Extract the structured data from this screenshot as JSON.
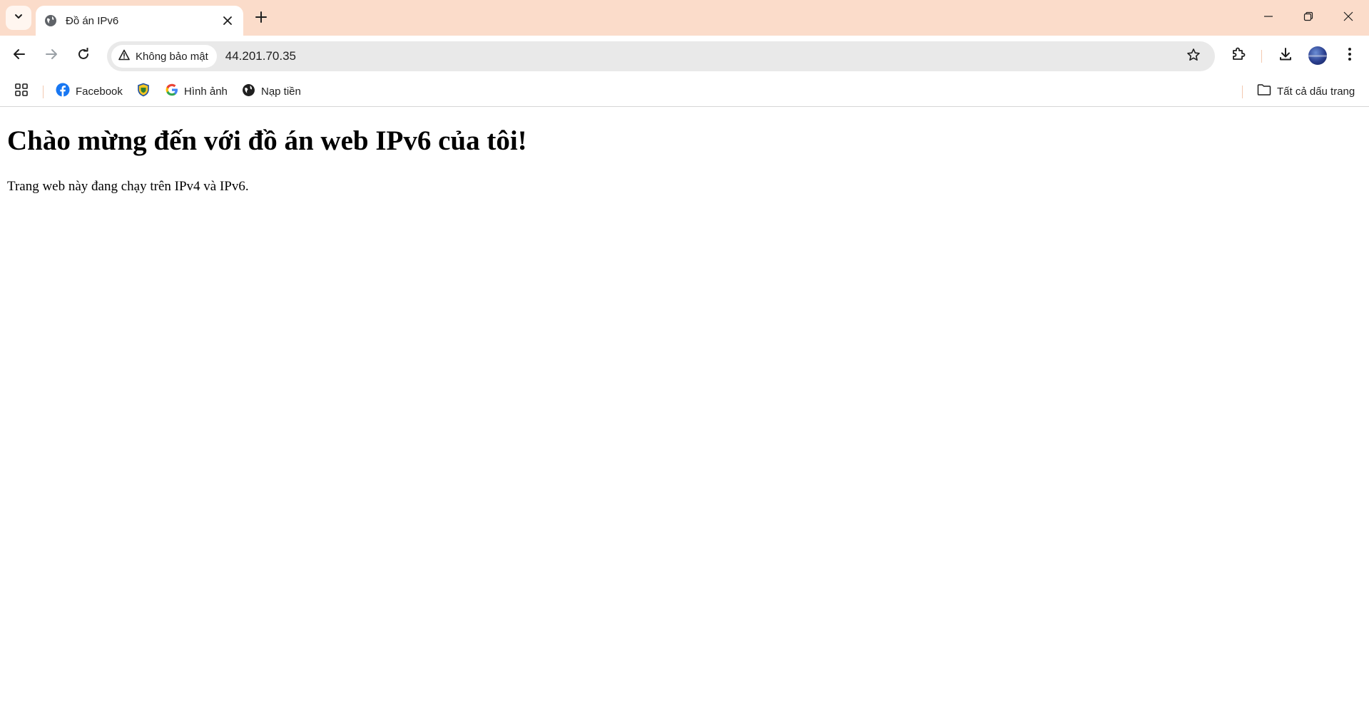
{
  "browser": {
    "tab": {
      "title": "Đồ án IPv6"
    },
    "omnibox": {
      "security_label": "Không bảo mật",
      "url": "44.201.70.35"
    },
    "bookmarks": [
      {
        "label": "Facebook",
        "icon": "facebook-icon"
      },
      {
        "label": "",
        "icon": "shield-badge-icon"
      },
      {
        "label": "Hình ảnh",
        "icon": "google-icon"
      },
      {
        "label": "Nạp tiền",
        "icon": "globe-icon"
      }
    ],
    "all_bookmarks_label": "Tất cả dấu trang",
    "colors": {
      "tab_strip": "#fbdcca",
      "omnibox_bg": "#e9e9e9",
      "facebook_blue": "#1877f2"
    }
  },
  "page": {
    "heading": "Chào mừng đến với đồ án web IPv6 của tôi!",
    "paragraph": "Trang web này đang chạy trên IPv4 và IPv6."
  }
}
